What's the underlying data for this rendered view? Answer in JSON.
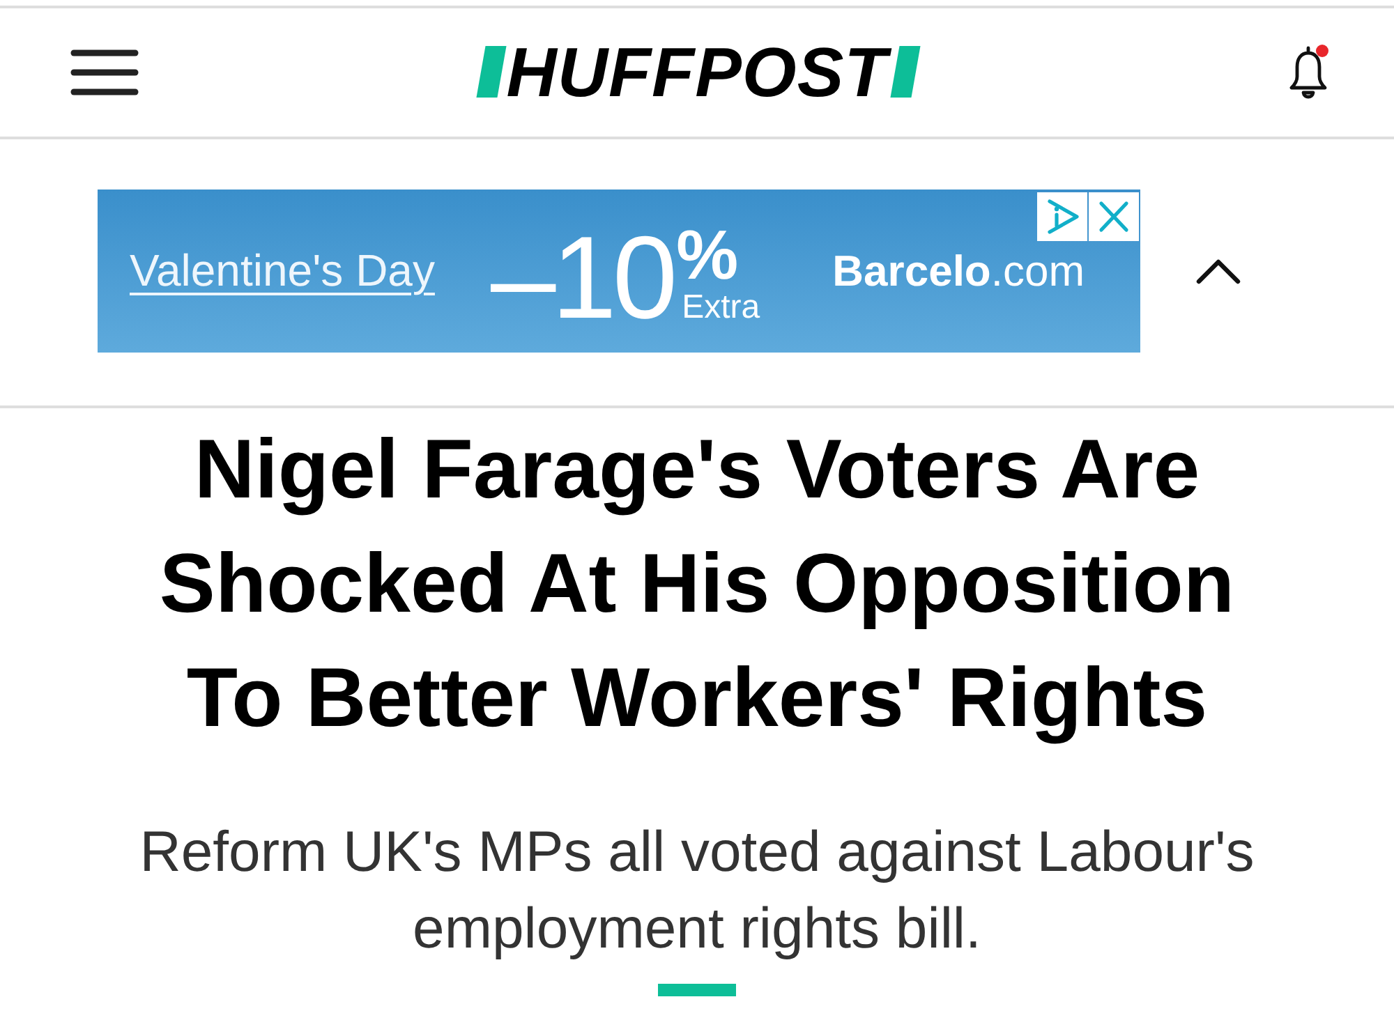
{
  "header": {
    "logo": "HUFFPOST",
    "notifications": {
      "unread": true
    }
  },
  "ad": {
    "expanded": true,
    "headline": "Valentine's Day",
    "discount": "–10",
    "discount_unit": "%",
    "discount_note": "Extra",
    "brand": "**Barcelo**.com"
  },
  "article": {
    "headline": "Nigel Farage's Voters Are Shocked At His Opposition To Better Workers' Rights",
    "subheading": "Reform UK's MPs all voted against Labour's employment rights bill."
  }
}
